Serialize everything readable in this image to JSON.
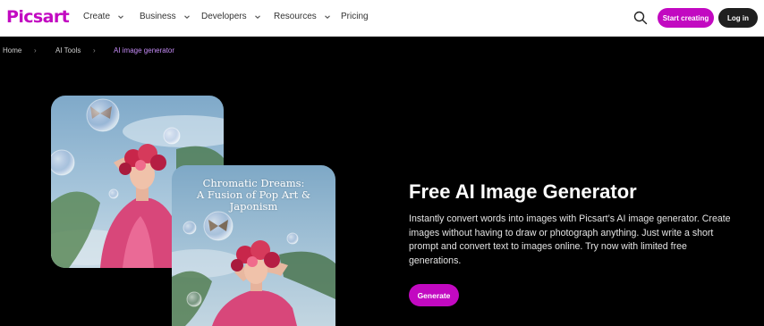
{
  "header": {
    "logo_text": "Picsart",
    "nav": [
      {
        "label": "Create",
        "has_dropdown": true
      },
      {
        "label": "Business",
        "has_dropdown": true
      },
      {
        "label": "Developers",
        "has_dropdown": true
      },
      {
        "label": "Resources",
        "has_dropdown": true
      },
      {
        "label": "Pricing",
        "has_dropdown": false
      }
    ],
    "search_icon": "search-icon",
    "start_label": "Start creating",
    "login_label": "Log in"
  },
  "breadcrumb": [
    "Home",
    "AI Tools",
    "AI image generator"
  ],
  "hero": {
    "image_caption_line1": "Chromatic Dreams:",
    "image_caption_line2": "A Fusion of Pop Art & Japonism",
    "title": "Free AI Image Generator",
    "description": "Instantly convert words into images with Picsart’s AI image generator. Create images without having to draw or photograph anything. Just write a short prompt and convert text to images online. Try now with limited free generations.",
    "cta_label": "Generate"
  },
  "colors": {
    "brand": "#c209c1",
    "background": "#000000",
    "breadcrumb_current": "#c58cf7"
  }
}
